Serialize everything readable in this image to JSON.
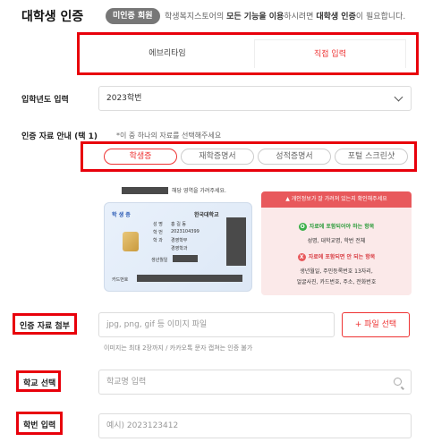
{
  "header": {
    "title": "대학생 인증",
    "badge": "미인증 회원",
    "note_pre": "학생복지스토어의 ",
    "note_b1": "모든 기능을 이용",
    "note_mid": "하시려면 ",
    "note_b2": "대학생 인증",
    "note_post": "이 필요합니다."
  },
  "tabs": [
    {
      "label": "에브리타임"
    },
    {
      "label": "직접 입력"
    }
  ],
  "admission": {
    "label": "입학년도 입력",
    "value": "2023학번"
  },
  "docs": {
    "label": "인증 자료 안내 (택 1)",
    "hint": "*이 중 하나의 자료를 선택해주세요",
    "options": [
      "학생증",
      "재학증명서",
      "성적증명서",
      "포털 스크린샷"
    ]
  },
  "sample": {
    "cover_note": "해당 영역을 가려주세요.",
    "card_label": "학 생 증",
    "university": "한국대학교",
    "name_label": "성 명",
    "name_value": "홍 길 동",
    "id_label": "학 번",
    "id_value": "2023104399",
    "dept_label": "학 과",
    "dept_value": "경영학부",
    "dept_value2": "경영학과",
    "birth_label": "생년월일",
    "card_no_label": "카드번호"
  },
  "warning": {
    "head": "▲ 개인정보가 잘 가려져 있는지 확인해주세요",
    "ok_title": "자료에 포함되어야 하는 항목",
    "ok_items": "성명, 대학교명, 학번 전체",
    "ng_title": "자료에 포함되면 안 되는 항목",
    "ng_items1": "생년월일, 주민등록번호 13자리,",
    "ng_items2": "얼굴사진, 카드번호, 주소, 전화번호",
    "ok_mark": "O",
    "ng_mark": "X"
  },
  "attach": {
    "label": "인증 자료 첨부",
    "placeholder": "jpg, png, gif 등 이미지 파일",
    "button": "+ 파일 선택",
    "help": "이미지는 최대 2장까지 / 카카오톡 문자 캡쳐는 인증 불가"
  },
  "school": {
    "label": "학교 선택",
    "placeholder": "학교명 입력"
  },
  "student_id": {
    "label": "학번 입력",
    "placeholder": "예시) 2023123412"
  },
  "colors": {
    "accent": "#e33333",
    "highlight_box": "#e8000b",
    "ok_green": "#3cb04a",
    "ng_red": "#e8595c"
  }
}
